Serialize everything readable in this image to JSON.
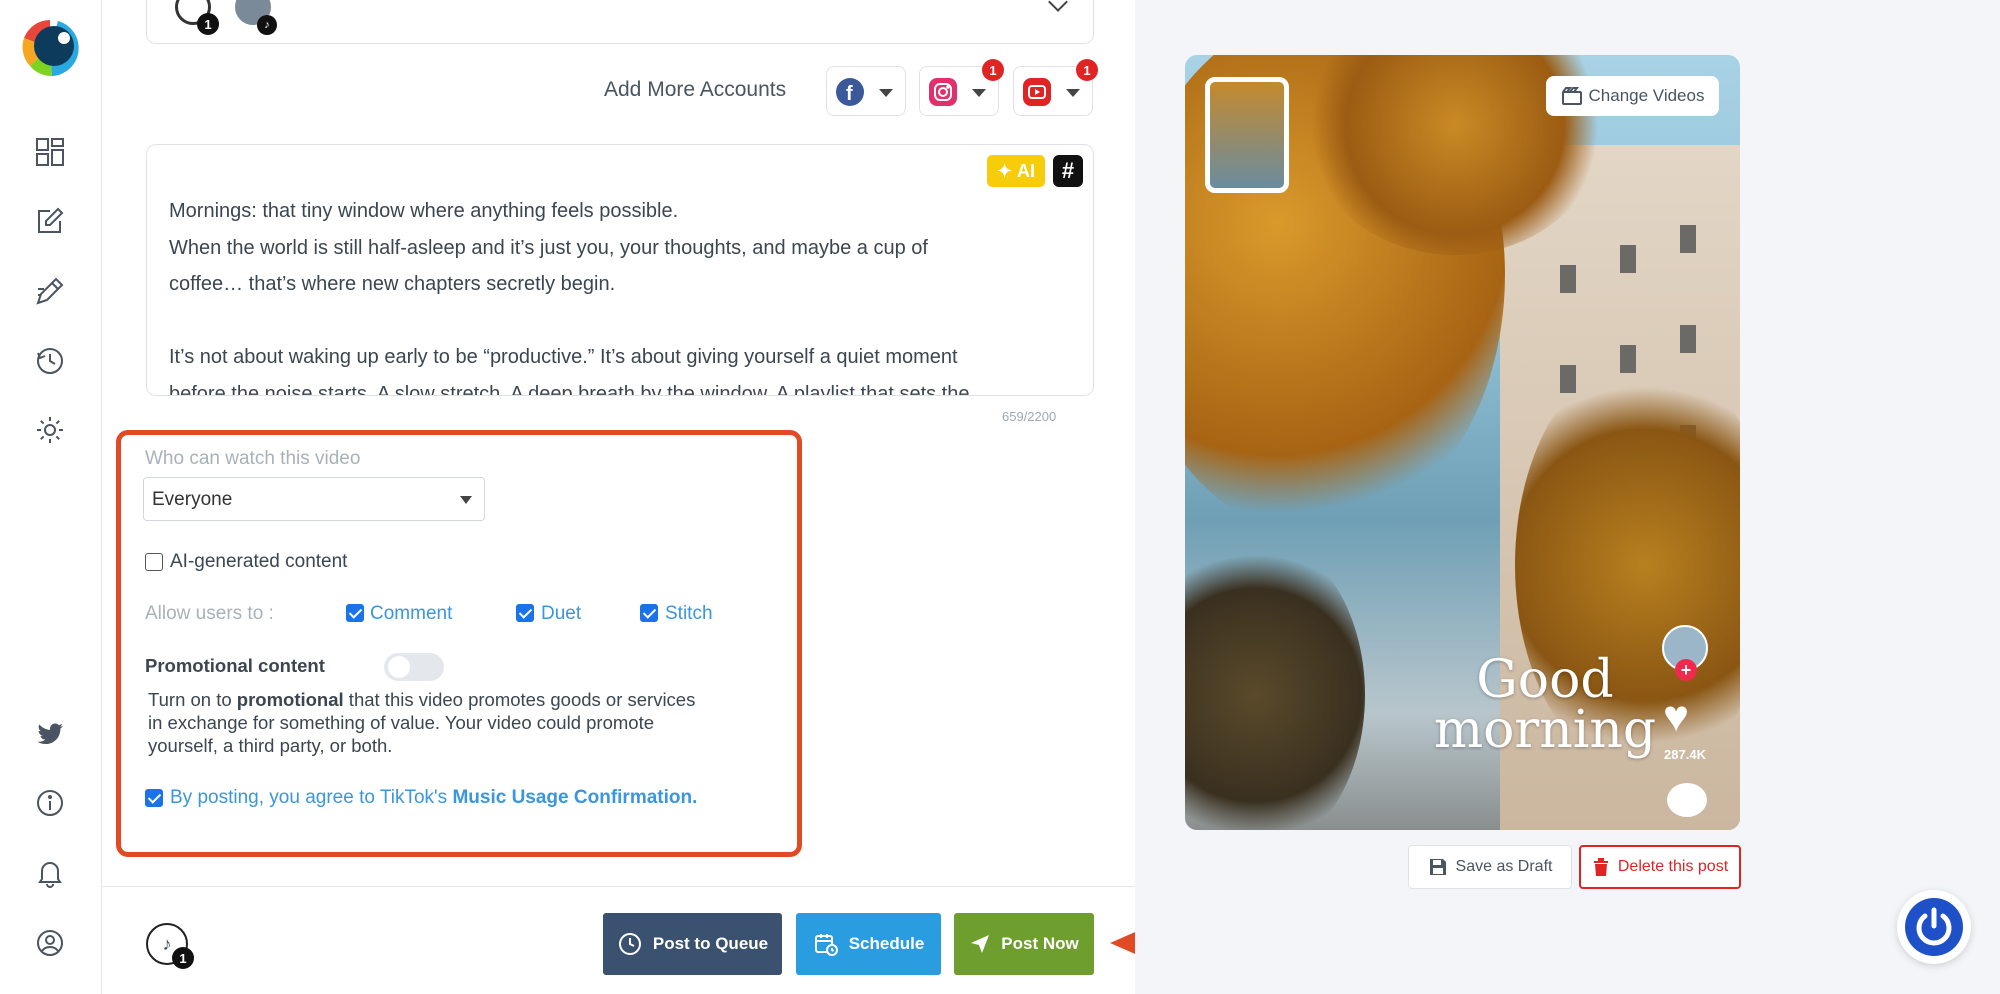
{
  "accounts": {
    "count_badge": "1"
  },
  "add_more": {
    "label": "Add More Accounts",
    "networks": [
      {
        "name": "facebook",
        "badge": ""
      },
      {
        "name": "instagram",
        "badge": "1"
      },
      {
        "name": "youtube",
        "badge": "1"
      }
    ]
  },
  "caption": {
    "ai_label": "AI",
    "hashtag_label": "#",
    "text": "Mornings: that tiny window where anything feels possible.\nWhen the world is still half-asleep and it’s just you, your thoughts, and maybe a cup of\ncoffee… that’s where new chapters secretly begin.\n\nIt’s not about waking up early to be “productive.” It’s about giving yourself a quiet moment\nbefore the noise starts. A slow stretch. A deep breath by the window. A playlist that sets the",
    "char_count": "659/2200"
  },
  "tiktok_settings": {
    "who_can_watch_label": "Who can watch this video",
    "who_can_watch_value": "Everyone",
    "ai_generated_label": "AI-generated content",
    "ai_generated_checked": false,
    "allow_users_label": "Allow users to :",
    "allow_comment": "Comment",
    "allow_duet": "Duet",
    "allow_stitch": "Stitch",
    "promotional_label": "Promotional content",
    "promotional_enabled": false,
    "promo_desc_prefix": "Turn on to ",
    "promo_desc_bold": "promotional",
    "promo_desc_suffix": " that this video promotes goods or services in exchange for something of value. Your video could promote yourself, a third party, or both.",
    "agree_prefix": "By posting, you agree to TikTok's ",
    "agree_link": "Music Usage Confirmation."
  },
  "footer": {
    "avatar_badge": "1",
    "post_to_queue": "Post to Queue",
    "schedule": "Schedule",
    "post_now": "Post Now"
  },
  "preview": {
    "change_videos": "Change Videos",
    "overlay_line1": "Good",
    "overlay_line2": "morning",
    "likes": "287.4K",
    "save_draft": "Save as Draft",
    "delete_post": "Delete this post"
  },
  "colors": {
    "accent_blue": "#2a9de0",
    "queue_btn": "#3a5170",
    "post_now_btn": "#6e9e2e",
    "highlight_box": "#e04b26",
    "danger": "#e02424"
  }
}
